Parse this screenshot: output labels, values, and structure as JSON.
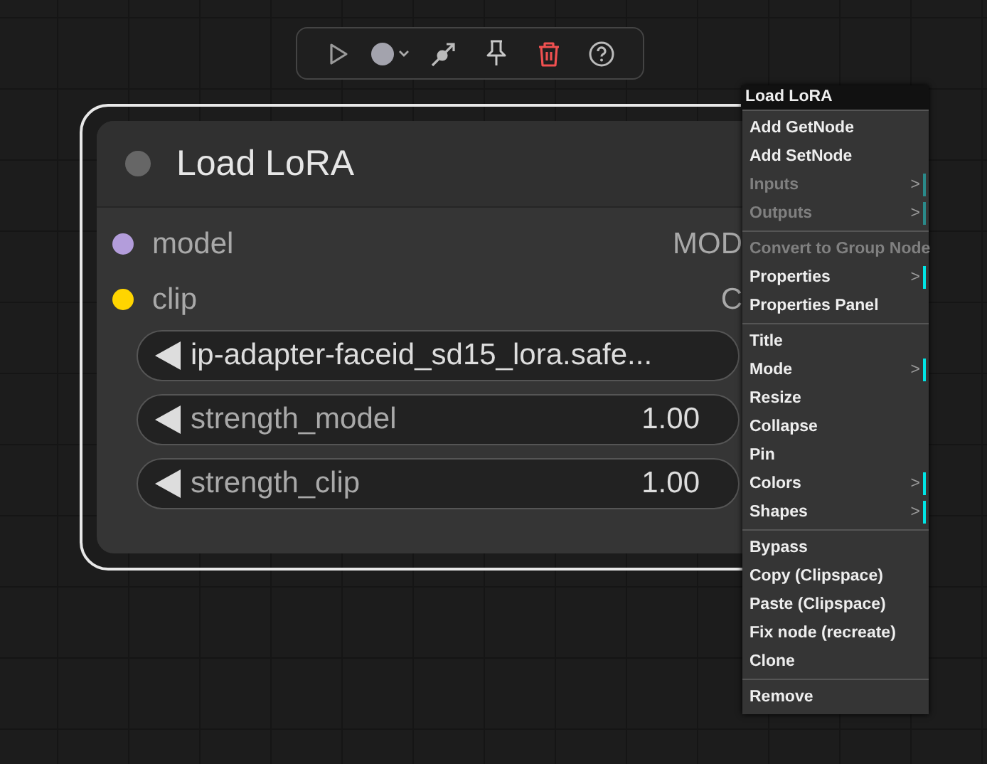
{
  "node": {
    "title": "Load LoRA",
    "inputs": [
      {
        "label": "model",
        "color": "#b39ddb",
        "output": "MOD"
      },
      {
        "label": "clip",
        "color": "#ffd500",
        "output": "C"
      }
    ],
    "widgets": [
      {
        "kind": "combo",
        "label": "ip-adapter-faceid_sd15_lora.safe..."
      },
      {
        "kind": "number",
        "label": "strength_model",
        "value": "1.00"
      },
      {
        "kind": "number",
        "label": "strength_clip",
        "value": "1.00"
      }
    ]
  },
  "menu": {
    "title": "Load LoRA",
    "groups": [
      [
        {
          "label": "Add GetNode",
          "disabled": false,
          "submenu": false
        },
        {
          "label": "Add SetNode",
          "disabled": false,
          "submenu": false
        },
        {
          "label": "Inputs",
          "disabled": true,
          "submenu": true,
          "arrow": ">"
        },
        {
          "label": "Outputs",
          "disabled": true,
          "submenu": true,
          "arrow": ">"
        }
      ],
      [
        {
          "label": "Convert to Group Node",
          "disabled": true,
          "submenu": false
        },
        {
          "label": "Properties",
          "disabled": false,
          "submenu": true,
          "arrow": ">"
        },
        {
          "label": "Properties Panel",
          "disabled": false,
          "submenu": false
        }
      ],
      [
        {
          "label": "Title",
          "disabled": false,
          "submenu": false
        },
        {
          "label": "Mode",
          "disabled": false,
          "submenu": true,
          "arrow": ">"
        },
        {
          "label": "Resize",
          "disabled": false,
          "submenu": false
        },
        {
          "label": "Collapse",
          "disabled": false,
          "submenu": false
        },
        {
          "label": "Pin",
          "disabled": false,
          "submenu": false
        },
        {
          "label": "Colors",
          "disabled": false,
          "submenu": true,
          "arrow": ">"
        },
        {
          "label": "Shapes",
          "disabled": false,
          "submenu": true,
          "arrow": ">"
        }
      ],
      [
        {
          "label": "Bypass",
          "disabled": false,
          "submenu": false
        },
        {
          "label": "Copy (Clipspace)",
          "disabled": false,
          "submenu": false
        },
        {
          "label": "Paste (Clipspace)",
          "disabled": false,
          "submenu": false
        },
        {
          "label": "Fix node (recreate)",
          "disabled": false,
          "submenu": false
        },
        {
          "label": "Clone",
          "disabled": false,
          "submenu": false
        }
      ],
      [
        {
          "label": "Remove",
          "disabled": false,
          "submenu": false
        }
      ]
    ]
  }
}
